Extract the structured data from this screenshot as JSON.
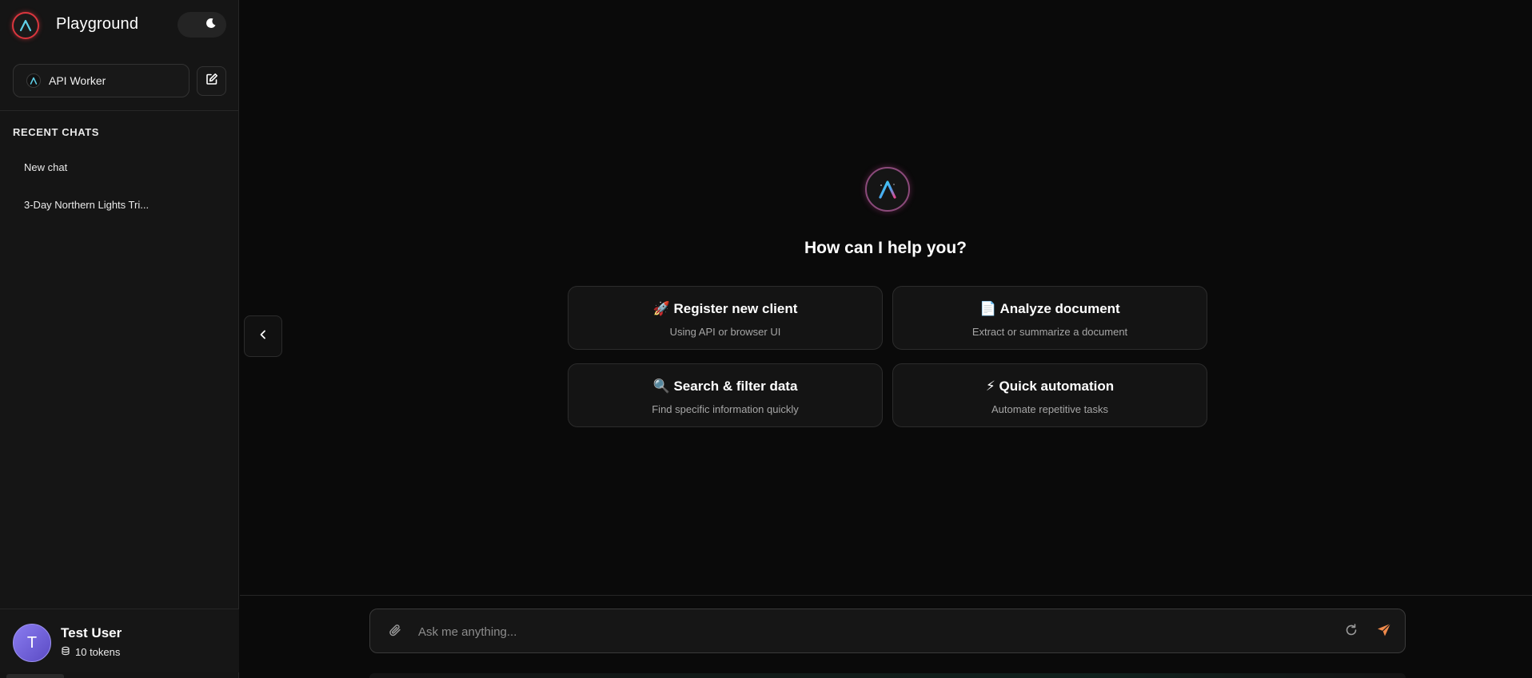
{
  "app": {
    "title": "Playground"
  },
  "sidebar": {
    "assistant": {
      "label": "API Worker"
    },
    "recent_heading": "RECENT CHATS",
    "chats": [
      {
        "label": "New chat"
      },
      {
        "label": "3-Day Northern Lights Tri..."
      }
    ]
  },
  "user": {
    "initial": "T",
    "name": "Test User",
    "tokens": "10 tokens"
  },
  "main": {
    "greeting": "How can I help you?",
    "suggestions": [
      {
        "title": "🚀 Register new client",
        "subtitle": "Using API or browser UI"
      },
      {
        "title": "📄 Analyze document",
        "subtitle": "Extract or summarize a document"
      },
      {
        "title": "🔍 Search & filter data",
        "subtitle": "Find specific information quickly"
      },
      {
        "title": "⚡ Quick automation",
        "subtitle": "Automate repetitive tasks"
      }
    ]
  },
  "composer": {
    "placeholder": "Ask me anything..."
  },
  "colors": {
    "accent_send": "#f08a4b",
    "logo_ring": "#d9363e",
    "avatar": "#7a6ce0"
  },
  "icons": {
    "theme": "moon-icon",
    "new_chat": "edit-icon",
    "collapse": "chevron-left-icon",
    "attach": "paperclip-icon",
    "refresh": "refresh-icon",
    "send": "send-icon",
    "tokens": "coins-icon"
  }
}
